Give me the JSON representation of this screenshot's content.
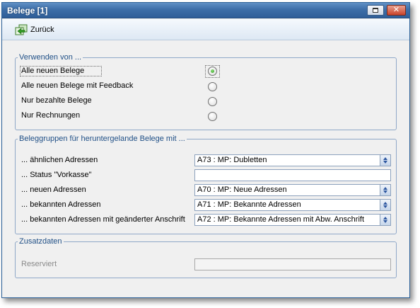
{
  "window": {
    "title": "Belege [1]"
  },
  "toolbar": {
    "back_label": "Zurück"
  },
  "verwenden": {
    "legend": "Verwenden von ...",
    "options": [
      {
        "label": "Alle neuen Belege",
        "checked": true
      },
      {
        "label": "Alle neuen Belege mit Feedback",
        "checked": false
      },
      {
        "label": "Nur bezahlte Belege",
        "checked": false
      },
      {
        "label": "Nur Rechnungen",
        "checked": false
      }
    ]
  },
  "beleggruppen": {
    "legend": "Beleggruppen für heruntergelande Belege mit ...",
    "rows": [
      {
        "label": "... ähnlichen Adressen",
        "value": "A73 : MP: Dubletten",
        "type": "combo"
      },
      {
        "label": "... Status \"Vorkasse\"",
        "value": "",
        "type": "text"
      },
      {
        "label": "... neuen Adressen",
        "value": "A70 : MP: Neue Adressen",
        "type": "combo"
      },
      {
        "label": "... bekannten Adressen",
        "value": "A71 : MP: Bekannte Adressen",
        "type": "combo"
      },
      {
        "label": "... bekannten Adressen mit geänderter Anschrift",
        "value": "A72 : MP: Bekannte Adressen mit Abw. Anschrift",
        "type": "combo"
      }
    ]
  },
  "zusatzdaten": {
    "legend": "Zusatzdaten",
    "reserviert_label": "Reserviert",
    "reserviert_value": ""
  },
  "colors": {
    "titlebar": "#3d6ea8",
    "group_border": "#8fa8c8",
    "legend_text": "#1f4f86",
    "radio_checked": "#2d9a1e"
  },
  "icons": {
    "back": "green-arrow-back-icon",
    "restore": "restore-icon",
    "close": "close-icon"
  }
}
